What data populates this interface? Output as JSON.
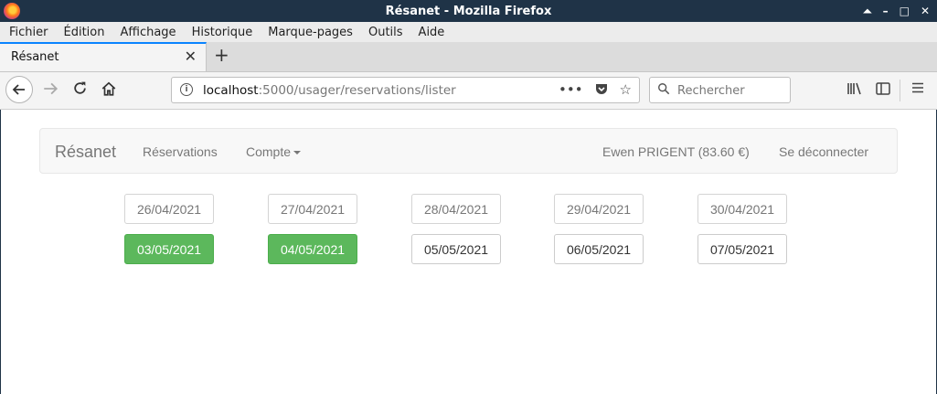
{
  "window": {
    "title": "Résanet - Mozilla Firefox",
    "controls": [
      "⏶",
      "–",
      "□",
      "✕"
    ]
  },
  "menu": [
    "Fichier",
    "Édition",
    "Affichage",
    "Historique",
    "Marque-pages",
    "Outils",
    "Aide"
  ],
  "tab": {
    "title": "Résanet",
    "close": "✕",
    "new": "+"
  },
  "toolbar": {
    "url_host": "localhost",
    "url_rest": ":5000/usager/reservations/lister",
    "search_placeholder": "Rechercher",
    "icons": [
      "back-icon",
      "forward-icon",
      "reload-icon",
      "home-icon",
      "page-actions-icon",
      "pocket-icon",
      "bookmark-star-icon",
      "search-icon",
      "library-icon",
      "sidebar-icon",
      "hamburger-menu-icon"
    ]
  },
  "site": {
    "brand": "Résanet",
    "nav_reservations": "Réservations",
    "nav_compte": "Compte",
    "user": "Ewen PRIGENT (83.60 €)",
    "logout": "Se déconnecter"
  },
  "dates": {
    "row1": [
      {
        "label": "26/04/2021",
        "state": "past"
      },
      {
        "label": "27/04/2021",
        "state": "past"
      },
      {
        "label": "28/04/2021",
        "state": "past"
      },
      {
        "label": "29/04/2021",
        "state": "past"
      },
      {
        "label": "30/04/2021",
        "state": "past"
      }
    ],
    "row2": [
      {
        "label": "03/05/2021",
        "state": "booked"
      },
      {
        "label": "04/05/2021",
        "state": "booked"
      },
      {
        "label": "05/05/2021",
        "state": "available"
      },
      {
        "label": "06/05/2021",
        "state": "available"
      },
      {
        "label": "07/05/2021",
        "state": "available"
      }
    ]
  },
  "colors": {
    "booked": "#5cb85c",
    "titlebar": "#1f3347",
    "tab_accent": "#0a84ff"
  }
}
